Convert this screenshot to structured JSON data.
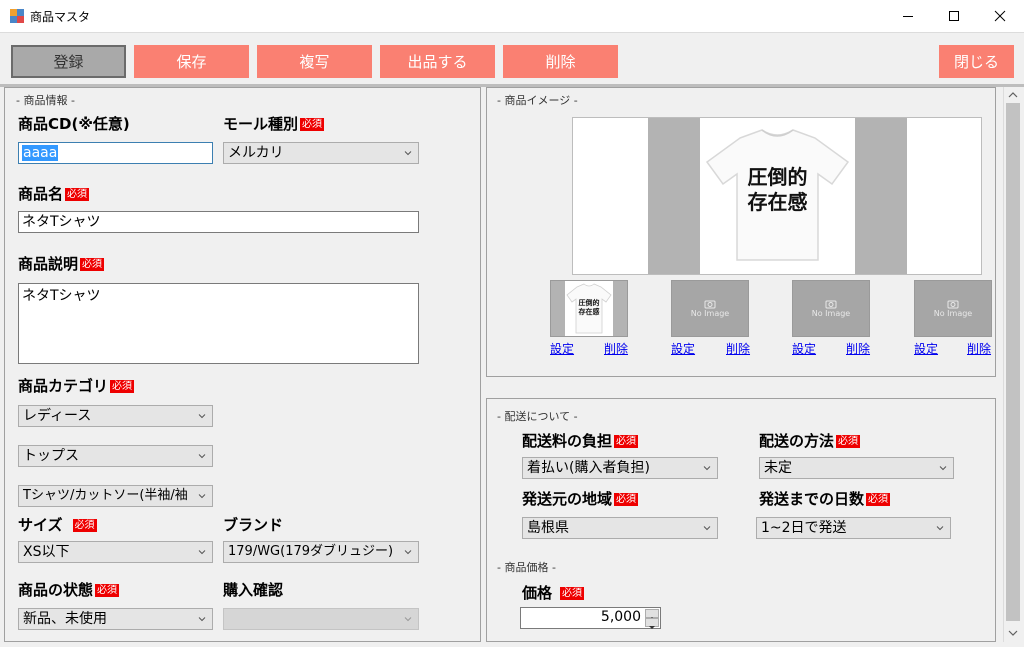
{
  "window": {
    "title": "商品マスタ",
    "controls": {
      "minimize": "—",
      "maximize": "☐",
      "close": "✕"
    }
  },
  "toolbar": {
    "register": "登録",
    "save": "保存",
    "copy": "複写",
    "list": "出品する",
    "delete": "削除",
    "close": "閉じる"
  },
  "product_info": {
    "section_title": "- 商品情報 -",
    "required_badge": "必須",
    "product_cd_label": "商品CD(※任意)",
    "product_cd_value": "aaaa",
    "mall_type_label": "モール種別",
    "mall_type_value": "メルカリ",
    "product_name_label": "商品名",
    "product_name_value": "ネタTシャツ",
    "description_label": "商品説明",
    "description_value": "ネタTシャツ",
    "category_label": "商品カテゴリ",
    "category_1": "レディース",
    "category_2": "トップス",
    "category_3": "Tシャツ/カットソー(半袖/袖",
    "size_label": "サイズ",
    "size_value": "XS以下",
    "brand_label": "ブランド",
    "brand_value": "179/WG(179ダブリュジー)",
    "condition_label": "商品の状態",
    "condition_value": "新品、未使用",
    "purchase_confirm_label": "購入確認",
    "purchase_confirm_value": ""
  },
  "product_image": {
    "section_title": "- 商品イメージ -",
    "tshirt_text_line1": "圧倒的",
    "tshirt_text_line2": "存在感",
    "no_image_text": "No Image",
    "set_link": "設定",
    "delete_link": "削除"
  },
  "shipping": {
    "section_title": "- 配送について -",
    "fee_burden_label": "配送料の負担",
    "fee_burden_value": "着払い(購入者負担)",
    "method_label": "配送の方法",
    "method_value": "未定",
    "origin_label": "発送元の地域",
    "origin_value": "島根県",
    "days_label": "発送までの日数",
    "days_value": "1~2日で発送"
  },
  "price": {
    "section_title": "- 商品価格 -",
    "label": "価格",
    "value": "5,000"
  },
  "colors": {
    "button_accent": "#fa8072",
    "required_badge": "#ee0000",
    "link": "#0000ee"
  }
}
